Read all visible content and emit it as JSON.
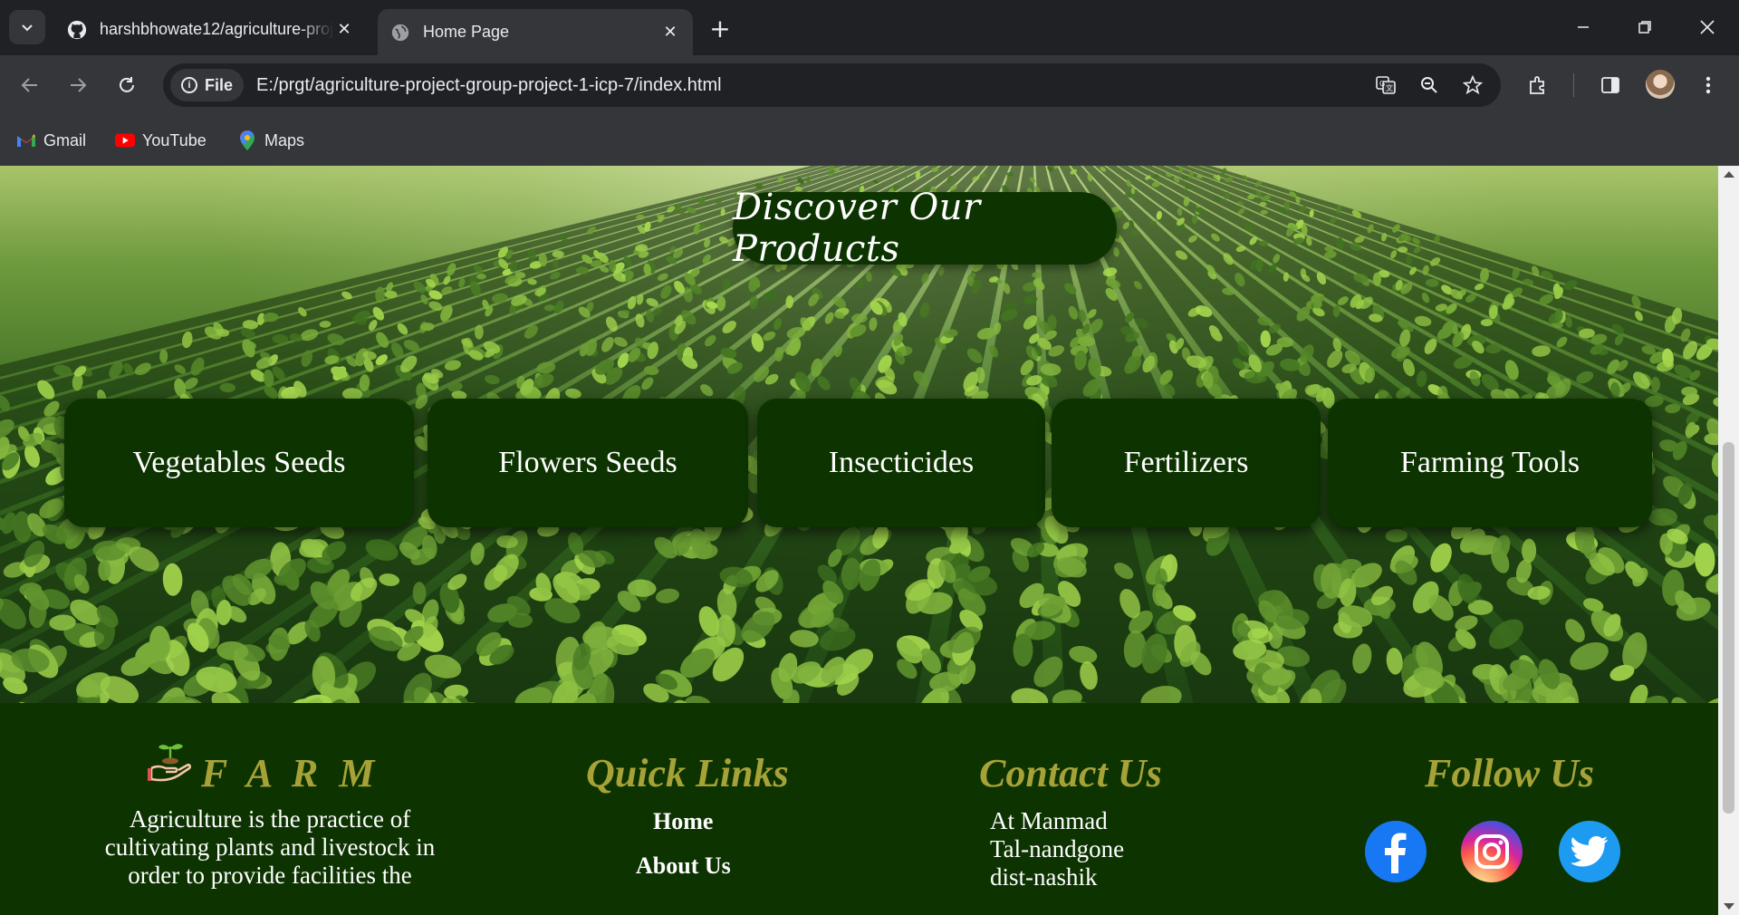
{
  "browser": {
    "tabs": [
      {
        "title": "harshbhowate12/agriculture-project-group-project-1-icp-7",
        "favicon": "github-icon",
        "active": false
      },
      {
        "title": "Home Page",
        "favicon": "globe-icon",
        "active": true
      }
    ],
    "new_tab_symbol": "+",
    "site_chip": "File",
    "url": "E:/prgt/agriculture-project-group-project-1-icp-7/index.html",
    "bookmarks": [
      {
        "label": "Gmail",
        "icon": "gmail-icon"
      },
      {
        "label": "YouTube",
        "icon": "youtube-icon"
      },
      {
        "label": "Maps",
        "icon": "maps-icon"
      }
    ]
  },
  "page": {
    "section_title": "Discover Our Products",
    "products": [
      "Vegetables Seeds",
      "Flowers Seeds",
      "Insecticides",
      "Fertilizers",
      "Farming Tools"
    ],
    "footer": {
      "brand": "F A R M",
      "about_text": "Agriculture is the practice of cultivating plants and livestock in order to provide facilities the",
      "quick_links_title": "Quick Links",
      "quick_links": [
        "Home",
        "About Us"
      ],
      "contact_title": "Contact Us",
      "contact_lines": [
        "At Manmad",
        "Tal-nandgone",
        "dist-nashik"
      ],
      "follow_title": "Follow Us",
      "social": [
        "facebook-icon",
        "instagram-icon",
        "twitter-icon"
      ]
    }
  },
  "colors": {
    "dark_green": "#0c3300",
    "gold": "#a7a237",
    "chrome_dark": "#202124",
    "chrome_mid": "#35363a"
  }
}
